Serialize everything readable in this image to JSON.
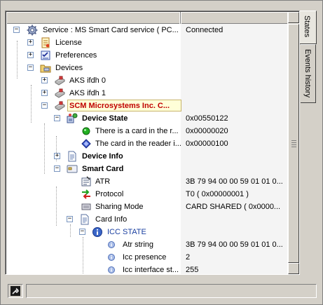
{
  "tabs": [
    {
      "label": "States",
      "active": true
    },
    {
      "label": "Events history",
      "active": false
    }
  ],
  "tree": {
    "rows": [
      {
        "name": "Service : MS Smart Card service   ( PC...",
        "value": "Connected",
        "icon": "gear-icon"
      },
      {
        "name": "License",
        "value": "",
        "icon": "license-icon"
      },
      {
        "name": "Preferences",
        "value": "",
        "icon": "checklist-icon"
      },
      {
        "name": "Devices",
        "value": "",
        "icon": "folder-devices-icon"
      },
      {
        "name": "AKS ifdh 0",
        "value": "",
        "icon": "card-reader-icon"
      },
      {
        "name": "AKS ifdh 1",
        "value": "",
        "icon": "card-reader-icon"
      },
      {
        "name": "SCM Microsystems Inc. C...",
        "value": "",
        "icon": "card-reader-icon"
      },
      {
        "name": "Device State",
        "value": "0x00550122",
        "icon": "device-state-icon"
      },
      {
        "name": "There is a card in the r...",
        "value": "0x00000020",
        "icon": "green-dot-icon"
      },
      {
        "name": "The card in the reader i...",
        "value": "0x00000100",
        "icon": "blue-diamond-icon"
      },
      {
        "name": "Device Info",
        "value": "",
        "icon": "document-icon"
      },
      {
        "name": "Smart Card",
        "value": "",
        "icon": "smart-card-icon"
      },
      {
        "name": "ATR",
        "value": "3B 79 94 00 00 59 01 01 0...",
        "icon": "atr-icon"
      },
      {
        "name": "Protocol",
        "value": "T0   ( 0x00000001 )",
        "icon": "protocol-arrows-icon"
      },
      {
        "name": "Sharing Mode",
        "value": "CARD SHARED    ( 0x0000...",
        "icon": "sharing-icon"
      },
      {
        "name": "Card Info",
        "value": "",
        "icon": "document-icon"
      },
      {
        "name": "ICC STATE",
        "value": "",
        "icon": "info-icon"
      },
      {
        "name": "Atr string",
        "value": "3B 79 94 00 00 59 01 01 0...",
        "icon": "info-small-icon"
      },
      {
        "name": "Icc presence",
        "value": "2",
        "icon": "info-small-icon"
      },
      {
        "name": "Icc interface st...",
        "value": "255",
        "icon": "info-small-icon"
      }
    ]
  },
  "colors": {
    "selected_text": "#c00000",
    "icc_state_text": "#1a3fa0"
  },
  "status_bar": {
    "text": ""
  }
}
